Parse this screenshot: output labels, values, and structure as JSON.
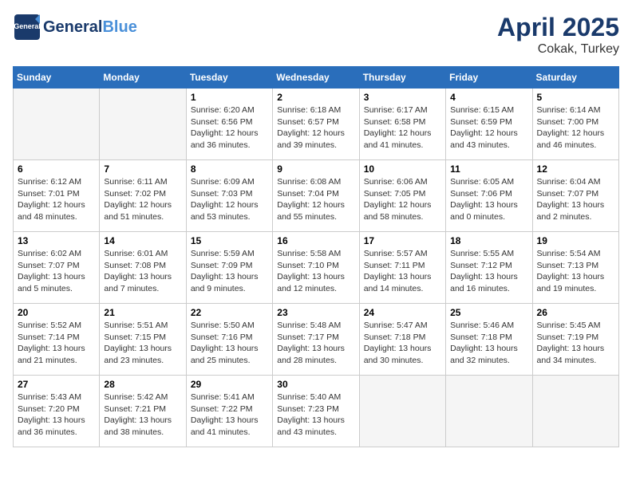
{
  "logo": {
    "line1": "General",
    "line2": "Blue",
    "tagline": ""
  },
  "title": {
    "month_year": "April 2025",
    "location": "Cokak, Turkey"
  },
  "weekdays": [
    "Sunday",
    "Monday",
    "Tuesday",
    "Wednesday",
    "Thursday",
    "Friday",
    "Saturday"
  ],
  "weeks": [
    [
      {
        "day": "",
        "info": ""
      },
      {
        "day": "",
        "info": ""
      },
      {
        "day": "1",
        "info": "Sunrise: 6:20 AM\nSunset: 6:56 PM\nDaylight: 12 hours\nand 36 minutes."
      },
      {
        "day": "2",
        "info": "Sunrise: 6:18 AM\nSunset: 6:57 PM\nDaylight: 12 hours\nand 39 minutes."
      },
      {
        "day": "3",
        "info": "Sunrise: 6:17 AM\nSunset: 6:58 PM\nDaylight: 12 hours\nand 41 minutes."
      },
      {
        "day": "4",
        "info": "Sunrise: 6:15 AM\nSunset: 6:59 PM\nDaylight: 12 hours\nand 43 minutes."
      },
      {
        "day": "5",
        "info": "Sunrise: 6:14 AM\nSunset: 7:00 PM\nDaylight: 12 hours\nand 46 minutes."
      }
    ],
    [
      {
        "day": "6",
        "info": "Sunrise: 6:12 AM\nSunset: 7:01 PM\nDaylight: 12 hours\nand 48 minutes."
      },
      {
        "day": "7",
        "info": "Sunrise: 6:11 AM\nSunset: 7:02 PM\nDaylight: 12 hours\nand 51 minutes."
      },
      {
        "day": "8",
        "info": "Sunrise: 6:09 AM\nSunset: 7:03 PM\nDaylight: 12 hours\nand 53 minutes."
      },
      {
        "day": "9",
        "info": "Sunrise: 6:08 AM\nSunset: 7:04 PM\nDaylight: 12 hours\nand 55 minutes."
      },
      {
        "day": "10",
        "info": "Sunrise: 6:06 AM\nSunset: 7:05 PM\nDaylight: 12 hours\nand 58 minutes."
      },
      {
        "day": "11",
        "info": "Sunrise: 6:05 AM\nSunset: 7:06 PM\nDaylight: 13 hours\nand 0 minutes."
      },
      {
        "day": "12",
        "info": "Sunrise: 6:04 AM\nSunset: 7:07 PM\nDaylight: 13 hours\nand 2 minutes."
      }
    ],
    [
      {
        "day": "13",
        "info": "Sunrise: 6:02 AM\nSunset: 7:07 PM\nDaylight: 13 hours\nand 5 minutes."
      },
      {
        "day": "14",
        "info": "Sunrise: 6:01 AM\nSunset: 7:08 PM\nDaylight: 13 hours\nand 7 minutes."
      },
      {
        "day": "15",
        "info": "Sunrise: 5:59 AM\nSunset: 7:09 PM\nDaylight: 13 hours\nand 9 minutes."
      },
      {
        "day": "16",
        "info": "Sunrise: 5:58 AM\nSunset: 7:10 PM\nDaylight: 13 hours\nand 12 minutes."
      },
      {
        "day": "17",
        "info": "Sunrise: 5:57 AM\nSunset: 7:11 PM\nDaylight: 13 hours\nand 14 minutes."
      },
      {
        "day": "18",
        "info": "Sunrise: 5:55 AM\nSunset: 7:12 PM\nDaylight: 13 hours\nand 16 minutes."
      },
      {
        "day": "19",
        "info": "Sunrise: 5:54 AM\nSunset: 7:13 PM\nDaylight: 13 hours\nand 19 minutes."
      }
    ],
    [
      {
        "day": "20",
        "info": "Sunrise: 5:52 AM\nSunset: 7:14 PM\nDaylight: 13 hours\nand 21 minutes."
      },
      {
        "day": "21",
        "info": "Sunrise: 5:51 AM\nSunset: 7:15 PM\nDaylight: 13 hours\nand 23 minutes."
      },
      {
        "day": "22",
        "info": "Sunrise: 5:50 AM\nSunset: 7:16 PM\nDaylight: 13 hours\nand 25 minutes."
      },
      {
        "day": "23",
        "info": "Sunrise: 5:48 AM\nSunset: 7:17 PM\nDaylight: 13 hours\nand 28 minutes."
      },
      {
        "day": "24",
        "info": "Sunrise: 5:47 AM\nSunset: 7:18 PM\nDaylight: 13 hours\nand 30 minutes."
      },
      {
        "day": "25",
        "info": "Sunrise: 5:46 AM\nSunset: 7:18 PM\nDaylight: 13 hours\nand 32 minutes."
      },
      {
        "day": "26",
        "info": "Sunrise: 5:45 AM\nSunset: 7:19 PM\nDaylight: 13 hours\nand 34 minutes."
      }
    ],
    [
      {
        "day": "27",
        "info": "Sunrise: 5:43 AM\nSunset: 7:20 PM\nDaylight: 13 hours\nand 36 minutes."
      },
      {
        "day": "28",
        "info": "Sunrise: 5:42 AM\nSunset: 7:21 PM\nDaylight: 13 hours\nand 38 minutes."
      },
      {
        "day": "29",
        "info": "Sunrise: 5:41 AM\nSunset: 7:22 PM\nDaylight: 13 hours\nand 41 minutes."
      },
      {
        "day": "30",
        "info": "Sunrise: 5:40 AM\nSunset: 7:23 PM\nDaylight: 13 hours\nand 43 minutes."
      },
      {
        "day": "",
        "info": ""
      },
      {
        "day": "",
        "info": ""
      },
      {
        "day": "",
        "info": ""
      }
    ]
  ]
}
